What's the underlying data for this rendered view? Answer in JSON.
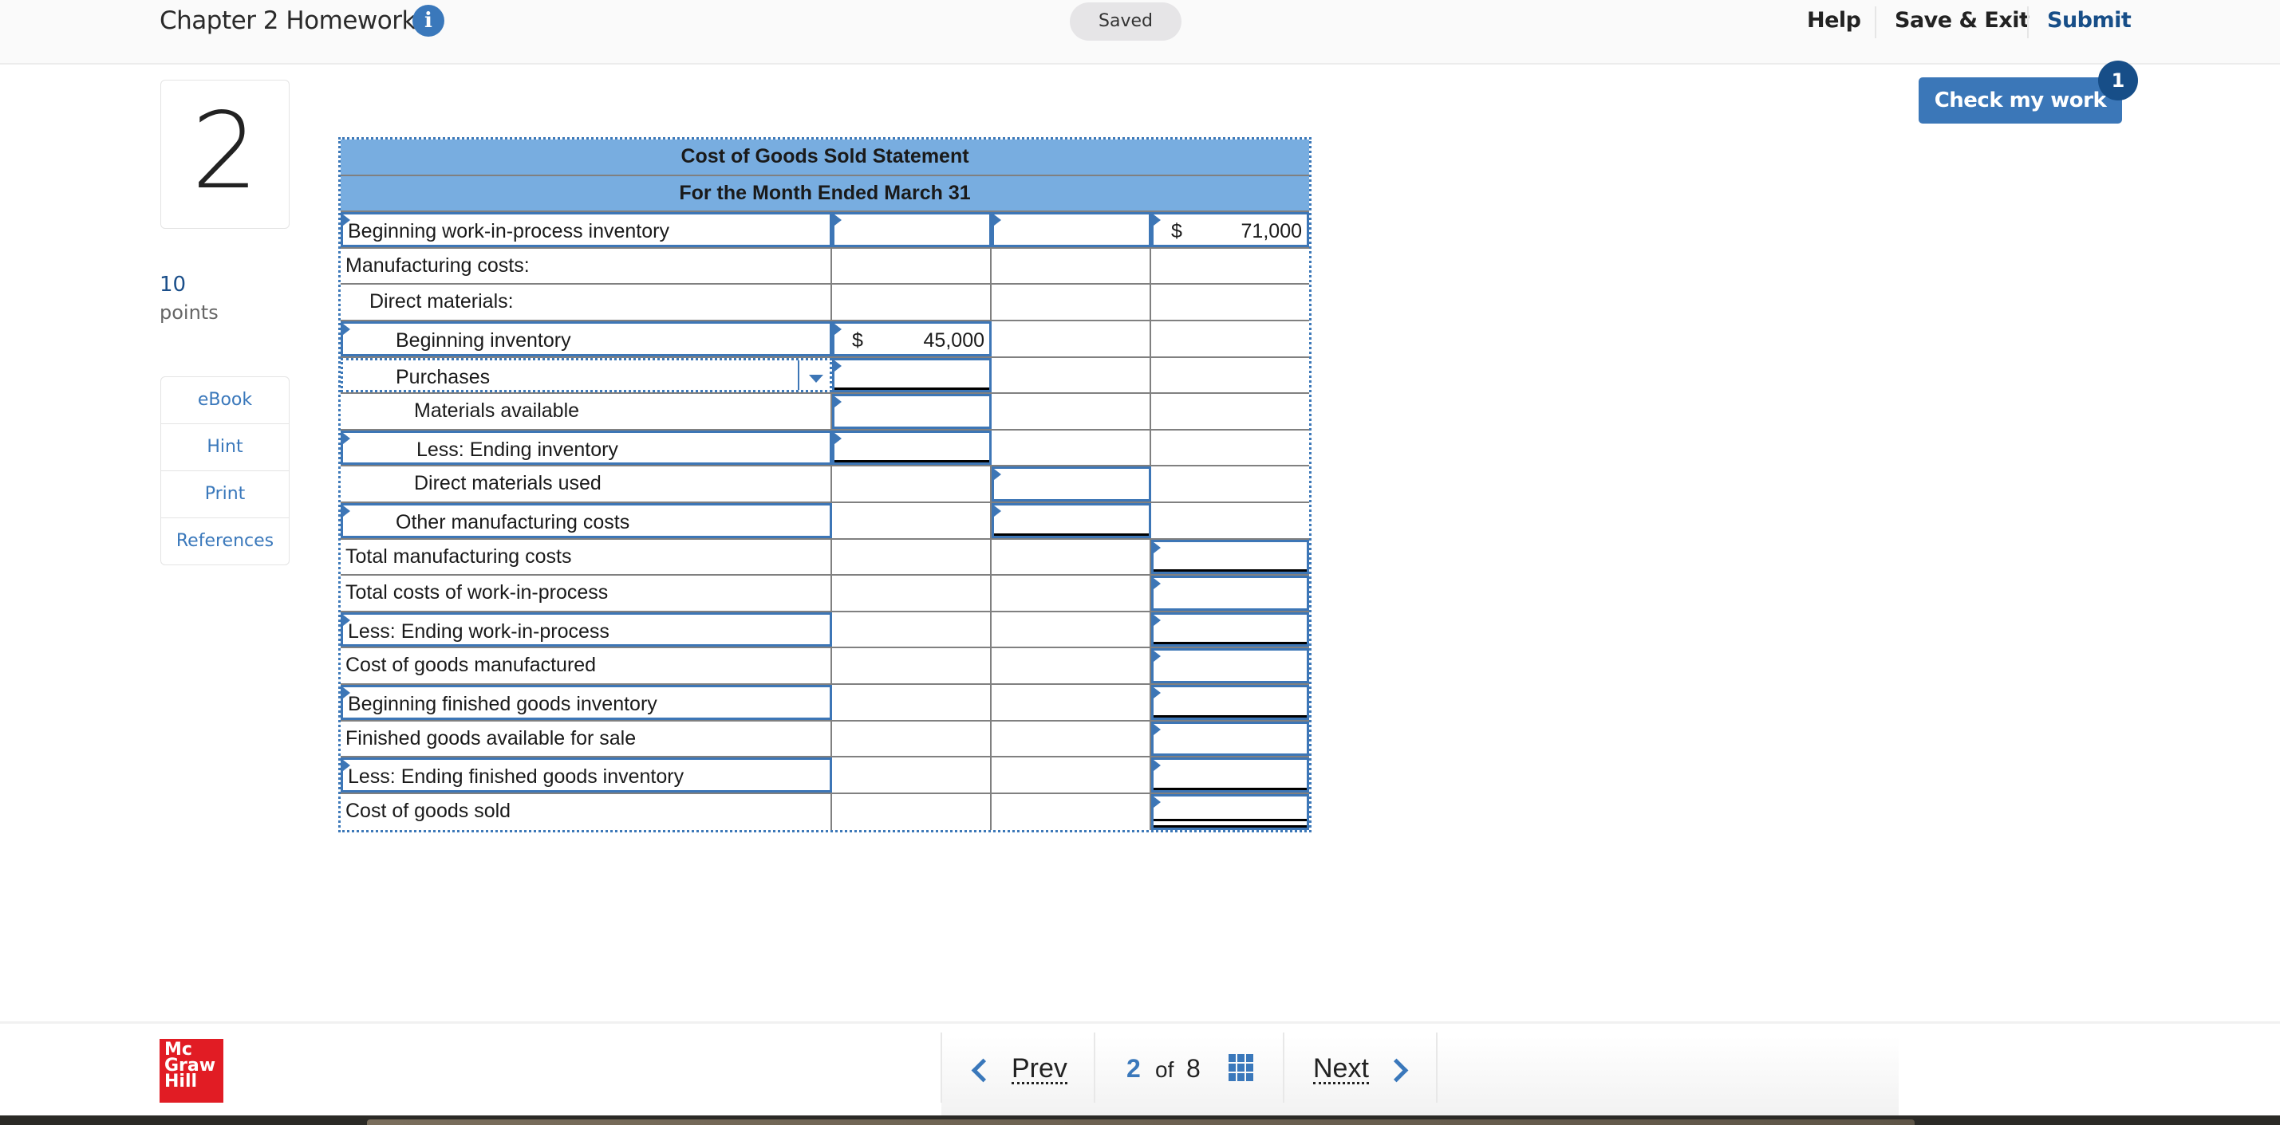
{
  "header": {
    "title": "Chapter 2 Homework",
    "info_icon": "info-icon",
    "status": "Saved",
    "links": {
      "help": "Help",
      "save_exit": "Save & Exit",
      "submit": "Submit"
    },
    "check_button": {
      "label": "Check my work",
      "badge": "1"
    }
  },
  "question": {
    "number": "2",
    "points_value": "10",
    "points_label": "points",
    "side_menu": [
      "eBook",
      "Hint",
      "Print",
      "References"
    ]
  },
  "statement": {
    "title": "Cost of Goods Sold Statement",
    "subtitle": "For the Month Ended March 31",
    "rows": [
      {
        "label": "Beginning work-in-process inventory",
        "indent": 0,
        "label_input": true,
        "col1": "",
        "col2": "",
        "col3_currency": "$",
        "col3": "71,000"
      },
      {
        "label": "Manufacturing costs:",
        "indent": 0
      },
      {
        "label": "Direct materials:",
        "indent": 1
      },
      {
        "label": "Beginning inventory",
        "indent": 2,
        "label_input": true,
        "col1_currency": "$",
        "col1": "45,000"
      },
      {
        "label": "Purchases",
        "indent": 2,
        "dropdown": true,
        "col1": ""
      },
      {
        "label": "Materials available",
        "indent": 3,
        "col1": ""
      },
      {
        "label": "Less: Ending inventory",
        "indent": 3,
        "label_input": true,
        "col1": ""
      },
      {
        "label": "Direct materials used",
        "indent": 3,
        "col2": ""
      },
      {
        "label": "Other manufacturing costs",
        "indent": 2,
        "label_input": true,
        "col2": ""
      },
      {
        "label": "Total manufacturing costs",
        "indent": 0,
        "col3": ""
      },
      {
        "label": "Total costs of work-in-process",
        "indent": 0,
        "col3": ""
      },
      {
        "label": "Less: Ending work-in-process",
        "indent": 0,
        "label_input": true,
        "col3": ""
      },
      {
        "label": "Cost of goods manufactured",
        "indent": 0,
        "col3": ""
      },
      {
        "label": "Beginning finished goods inventory",
        "indent": 0,
        "label_input": true,
        "col3": ""
      },
      {
        "label": "Finished goods available for sale",
        "indent": 0,
        "col3": ""
      },
      {
        "label": "Less: Ending finished goods inventory",
        "indent": 0,
        "label_input": true,
        "col3": ""
      },
      {
        "label": "Cost of goods sold",
        "indent": 0,
        "col3": ""
      }
    ]
  },
  "footer": {
    "logo": [
      "Mc",
      "Graw",
      "Hill"
    ],
    "prev": "Prev",
    "next": "Next",
    "current_page": "2",
    "of": "of",
    "total_pages": "8"
  },
  "colors": {
    "accent": "#3a78bb",
    "header_fill": "#78ade0",
    "submit": "#174e88",
    "logo": "#e11c24"
  }
}
